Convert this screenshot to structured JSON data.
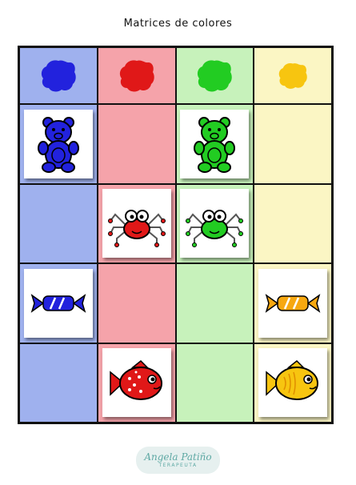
{
  "title": "Matrices de colores",
  "colors": {
    "blue": "#2222dd",
    "red": "#e01818",
    "green": "#22cc22",
    "yellow": "#f7c510"
  },
  "column_backgrounds": [
    "#9fb1ee",
    "#f5a3aa",
    "#c7f2bb",
    "#fbf6c4"
  ],
  "header_row": [
    {
      "icon": "blue-paint-blob-icon",
      "color": "blue"
    },
    {
      "icon": "red-paint-blob-icon",
      "color": "red"
    },
    {
      "icon": "green-paint-blob-icon",
      "color": "green"
    },
    {
      "icon": "yellow-paint-blob-icon",
      "color": "yellow"
    }
  ],
  "rows": [
    {
      "item": "bear",
      "cells": [
        "blue-bear-icon",
        null,
        "green-bear-icon",
        null
      ]
    },
    {
      "item": "spider",
      "cells": [
        null,
        "red-spider-icon",
        "green-spider-icon",
        null
      ]
    },
    {
      "item": "candy",
      "cells": [
        "blue-candy-icon",
        null,
        null,
        "yellow-candy-icon"
      ]
    },
    {
      "item": "fish",
      "cells": [
        null,
        "red-fish-icon",
        null,
        "yellow-fish-icon"
      ]
    }
  ],
  "footer": {
    "name": "Angela Patiño",
    "subtitle": "TERAPEUTA"
  }
}
